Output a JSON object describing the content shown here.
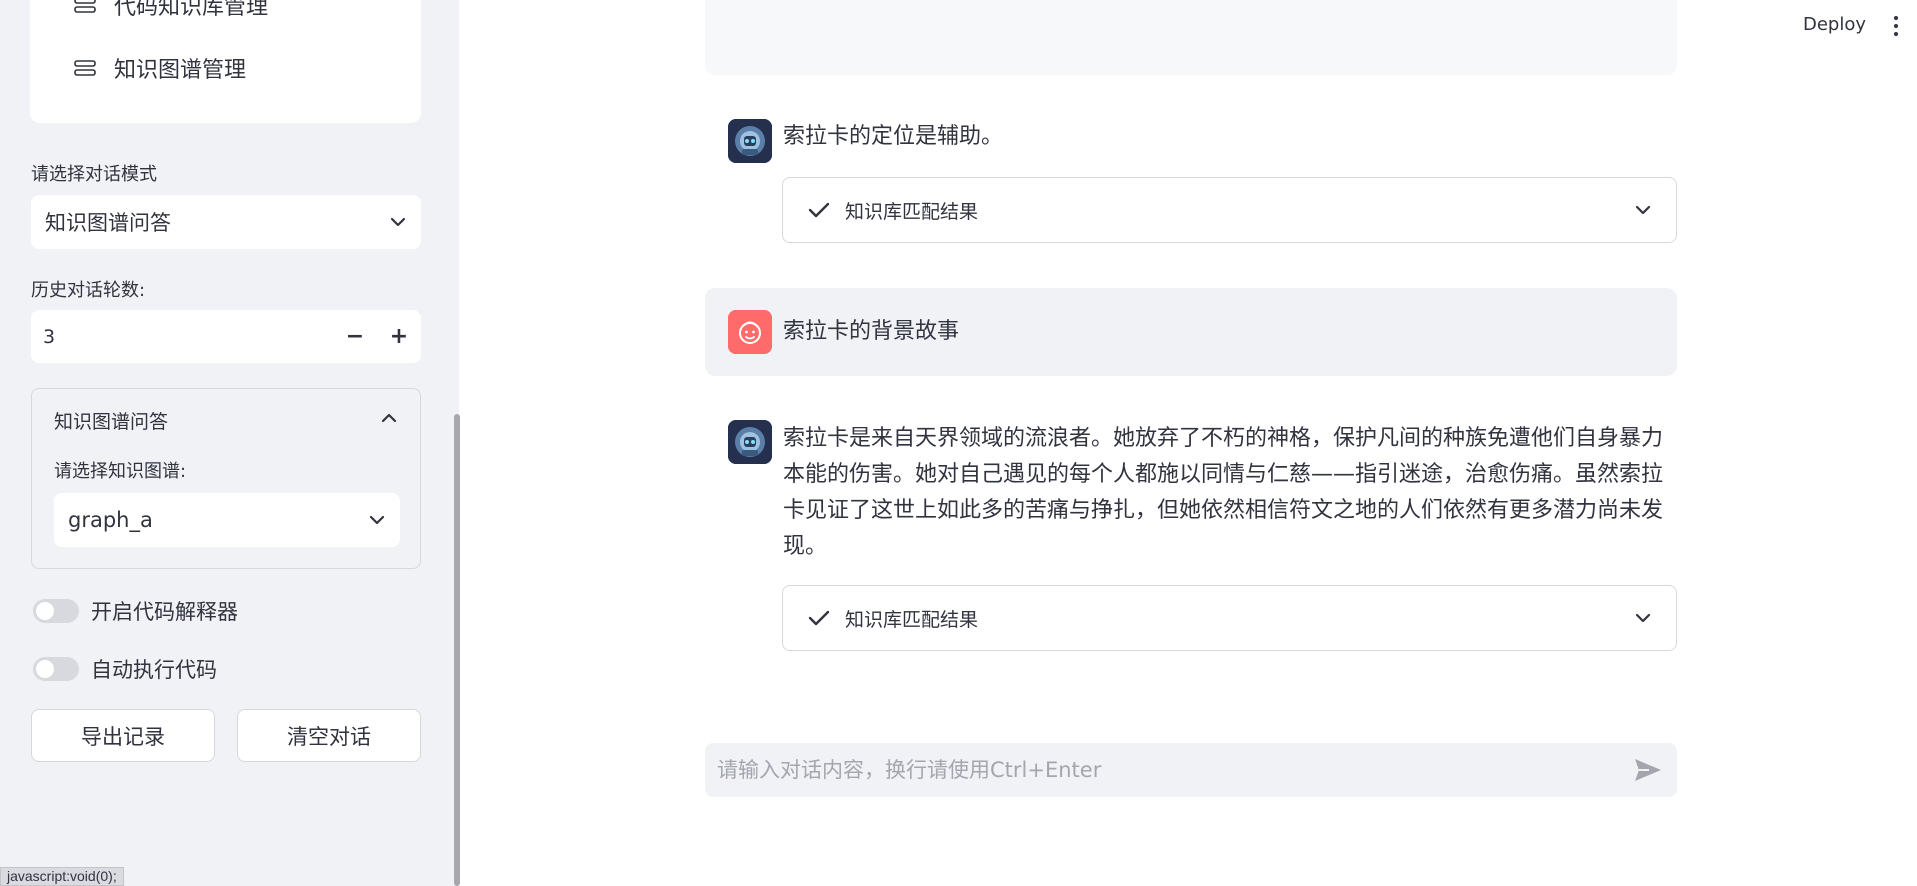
{
  "sidebar": {
    "nav_items": [
      {
        "label": "代码知识库管理"
      },
      {
        "label": "知识图谱管理"
      }
    ],
    "dialog_mode": {
      "label": "请选择对话模式",
      "value": "知识图谱问答"
    },
    "history_rounds": {
      "label": "历史对话轮数:",
      "value": "3",
      "minus": "−",
      "plus": "+"
    },
    "kg_expander": {
      "title": "知识图谱问答",
      "select_label": "请选择知识图谱:",
      "select_value": "graph_a"
    },
    "toggles": [
      {
        "label": "开启代码解释器"
      },
      {
        "label": "自动执行代码"
      }
    ],
    "buttons": {
      "export": "导出记录",
      "clear": "清空对话"
    }
  },
  "status_tip": "javascript:void(0);",
  "header": {
    "deploy": "Deploy"
  },
  "chat": {
    "messages": [
      {
        "role": "assistant",
        "text": "索拉卡的定位是辅助。",
        "result_label": "知识库匹配结果"
      },
      {
        "role": "user",
        "text": "索拉卡的背景故事"
      },
      {
        "role": "assistant",
        "lines": [
          "索拉卡是来自天界领域的流浪者。她放弃了不朽的神格，保护凡间的种族免遭他们自身暴力",
          "本能的伤害。她对自己遇见的每个人都施以同情与仁慈——指引迷途，治愈伤痛。虽然索拉",
          "卡见证了这世上如此多的苦痛与挣扎，但她依然相信符文之地的人们依然有更多潜力尚未发",
          "现。"
        ],
        "result_label": "知识库匹配结果"
      }
    ],
    "input": {
      "placeholder": "请输入对话内容，换行请使用Ctrl+Enter",
      "value": ""
    }
  },
  "colors": {
    "sidebar_bg": "#f0f2f6",
    "user_avatar": "#ff6b6b",
    "bot_avatar": "#2e3a5a",
    "text": "#31333f"
  }
}
